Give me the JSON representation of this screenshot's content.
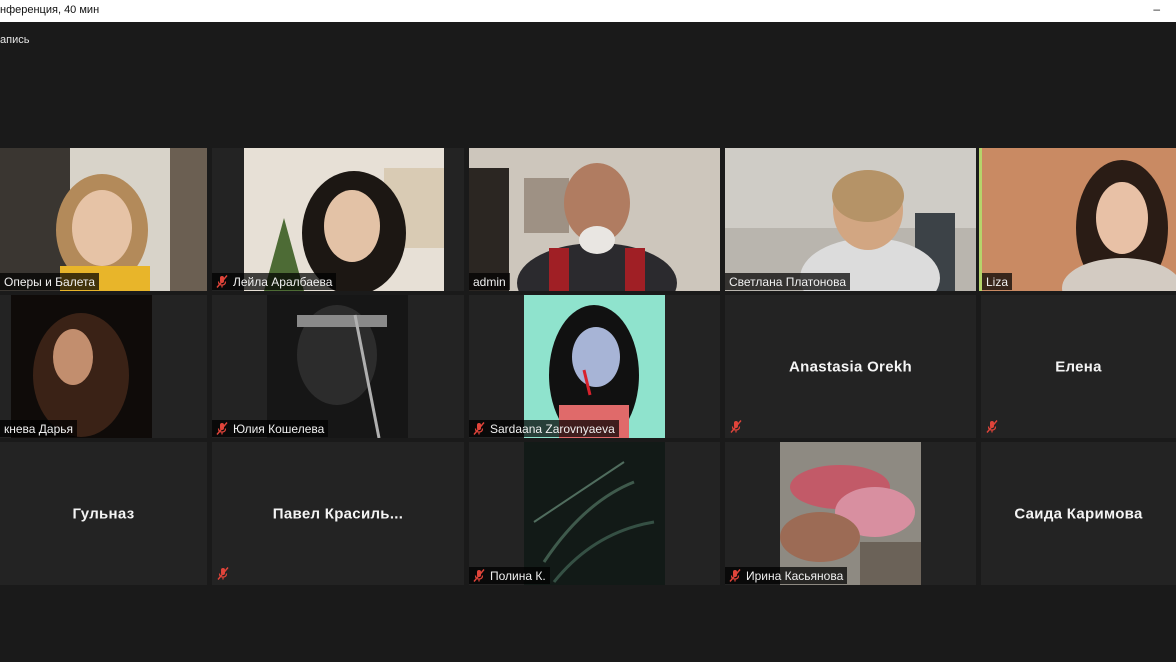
{
  "window": {
    "title": "нференция, 40 мин",
    "minimize_glyph": "–"
  },
  "recording": {
    "label": "апись"
  },
  "participants": [
    {
      "name": "Оперы и Балета",
      "video": true,
      "muted": false
    },
    {
      "name": "Лейла Аралбаева",
      "video": true,
      "muted": true
    },
    {
      "name": "admin",
      "video": true,
      "muted": false
    },
    {
      "name": "Светлана Платонова",
      "video": true,
      "muted": false
    },
    {
      "name": "Liza",
      "video": true,
      "muted": false,
      "active_speaker": true
    },
    {
      "name": "кнева Дарья",
      "video": true,
      "muted": false
    },
    {
      "name": "Юлия Кошелева",
      "video": true,
      "muted": true
    },
    {
      "name": "Sardaana Zarovnyaeva",
      "video": true,
      "muted": true
    },
    {
      "name": "Anastasia  Orekh",
      "video": false,
      "muted": true
    },
    {
      "name": "Елена",
      "video": false,
      "muted": true
    },
    {
      "name": "Гульназ",
      "video": false,
      "muted": false
    },
    {
      "name": "Павел  Красиль...",
      "video": false,
      "muted": true
    },
    {
      "name": "Полина К.",
      "video": true,
      "muted": true
    },
    {
      "name": "Ирина Касьянова",
      "video": true,
      "muted": true
    },
    {
      "name": "Саида Каримова",
      "video": false,
      "muted": false
    }
  ],
  "colors": {
    "background": "#1a1a1a",
    "tile": "#232323",
    "active_speaker_border": "#b5d46b",
    "muted_icon": "#e0443a"
  },
  "icons": {
    "muted": "microphone-muted-icon"
  }
}
